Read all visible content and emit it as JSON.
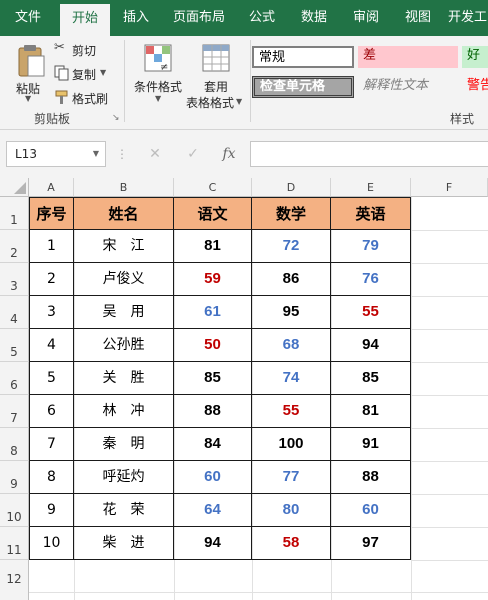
{
  "ribbon_tabs": [
    "文件",
    "开始",
    "插入",
    "页面布局",
    "公式",
    "数据",
    "审阅",
    "视图",
    "开发工"
  ],
  "clipboard": {
    "paste": "粘贴",
    "cut": "剪切",
    "copy": "复制",
    "format_painter": "格式刷",
    "group_label": "剪贴板"
  },
  "conditional_format": "条件格式",
  "table_format_line1": "套用",
  "table_format_line2": "表格格式",
  "styles": {
    "normal": "常规",
    "bad": "差",
    "good": "好",
    "check_cell": "检查单元格",
    "explanatory": "解释性文本",
    "warning": "警告",
    "group_label": "样式"
  },
  "name_box": "L13",
  "formula_value": "",
  "colors": {
    "ribbon_green": "#217346",
    "header_fill": "#f4b183",
    "blue_text": "#4472c4",
    "red_text": "#c00000",
    "bad_fill": "#ffc7ce",
    "bad_text": "#9c0006",
    "good_fill": "#c6efce",
    "good_text": "#006100"
  },
  "columns": [
    "A",
    "B",
    "C",
    "D",
    "E",
    "F"
  ],
  "row_numbers": [
    "1",
    "2",
    "3",
    "4",
    "5",
    "6",
    "7",
    "8",
    "9",
    "10",
    "11",
    "12"
  ],
  "table": {
    "headers": [
      "序号",
      "姓名",
      "语文",
      "数学",
      "英语"
    ],
    "rows": [
      {
        "id": "1",
        "name": "宋　江",
        "chinese": "81",
        "math": "72",
        "english": "79",
        "colors": [
          "black",
          "blue",
          "blue"
        ]
      },
      {
        "id": "2",
        "name": "卢俊义",
        "chinese": "59",
        "math": "86",
        "english": "76",
        "colors": [
          "red",
          "black",
          "blue"
        ]
      },
      {
        "id": "3",
        "name": "吴　用",
        "chinese": "61",
        "math": "95",
        "english": "55",
        "colors": [
          "blue",
          "black",
          "red"
        ]
      },
      {
        "id": "4",
        "name": "公孙胜",
        "chinese": "50",
        "math": "68",
        "english": "94",
        "colors": [
          "red",
          "blue",
          "black"
        ]
      },
      {
        "id": "5",
        "name": "关　胜",
        "chinese": "85",
        "math": "74",
        "english": "85",
        "colors": [
          "black",
          "blue",
          "black"
        ]
      },
      {
        "id": "6",
        "name": "林　冲",
        "chinese": "88",
        "math": "55",
        "english": "81",
        "colors": [
          "black",
          "red",
          "black"
        ]
      },
      {
        "id": "7",
        "name": "秦　明",
        "chinese": "84",
        "math": "100",
        "english": "91",
        "colors": [
          "black",
          "black",
          "black"
        ]
      },
      {
        "id": "8",
        "name": "呼延灼",
        "chinese": "60",
        "math": "77",
        "english": "88",
        "colors": [
          "blue",
          "blue",
          "black"
        ]
      },
      {
        "id": "9",
        "name": "花　荣",
        "chinese": "64",
        "math": "80",
        "english": "60",
        "colors": [
          "blue",
          "blue",
          "blue"
        ]
      },
      {
        "id": "10",
        "name": "柴　进",
        "chinese": "94",
        "math": "58",
        "english": "97",
        "colors": [
          "black",
          "red",
          "black"
        ]
      }
    ]
  }
}
